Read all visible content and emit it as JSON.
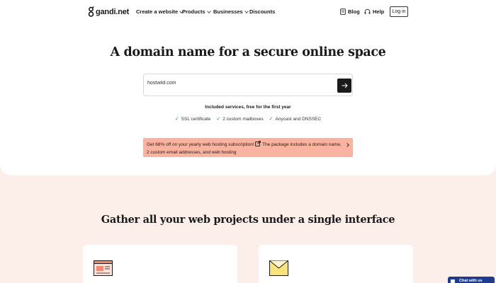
{
  "header": {
    "logo_text": "gandi.net",
    "nav": [
      {
        "label": "Create a website",
        "has_dropdown": true
      },
      {
        "label": "Products",
        "has_dropdown": true
      },
      {
        "label": "Businesses",
        "has_dropdown": true
      },
      {
        "label": "Discounts",
        "has_dropdown": false
      }
    ],
    "blog_label": "Blog",
    "help_label": "Help",
    "login_label": "Log in"
  },
  "hero": {
    "title": "A domain name for a secure online space",
    "search_value": "hostwild.com",
    "included_heading": "Included services, free for the first year",
    "services": [
      "SSL certificate",
      "2 custom mailboxes",
      "Anycast and DNSSEC"
    ],
    "promo_part1": "Get 68% off on your yearly web hosting subscription!",
    "promo_part2": "The package includes a domain name, 2 custom email addresses, and web hosting"
  },
  "section": {
    "title": "Gather all your web projects under a single interface"
  },
  "chat": {
    "label": "Chat with us"
  },
  "colors": {
    "accent_promo": "#f9b39e",
    "page_background": "#fcefe9",
    "search_button": "#1b1b1b",
    "chat_button": "#1d3c8f",
    "check": "#2f8a5a"
  },
  "icons": {
    "logo": "gandi-logo-icon",
    "blog": "blog-icon",
    "help": "headset-icon",
    "search_submit": "arrow-right-icon",
    "promo_external": "external-link-icon",
    "card_left": "browser-window-icon",
    "card_right": "envelope-icon"
  }
}
